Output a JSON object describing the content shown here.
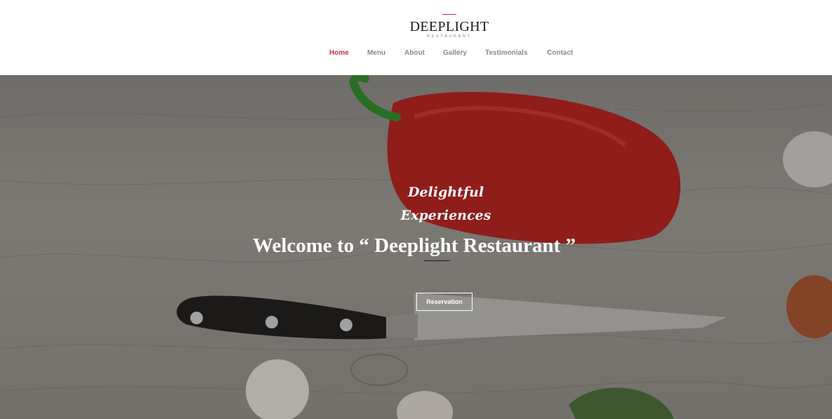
{
  "brand": {
    "name": "DEEPLIGHT",
    "subtitle": "RESTAURANT",
    "accent_color": "#c9303e"
  },
  "nav": {
    "items": [
      {
        "label": "Home",
        "active": true
      },
      {
        "label": "Menu",
        "active": false
      },
      {
        "label": "About",
        "active": false
      },
      {
        "label": "Gallery",
        "active": false
      },
      {
        "label": "Testimonials",
        "active": false
      },
      {
        "label": "Contact",
        "active": false
      }
    ]
  },
  "hero": {
    "script_line1": "Delightful",
    "script_line2": "Experiences",
    "headline": "Welcome to “ Deeplight Restaurant ”",
    "button_label": "Reservation"
  }
}
